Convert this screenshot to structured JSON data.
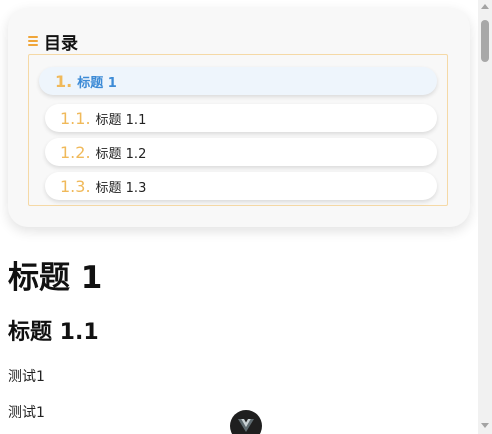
{
  "toc": {
    "title": "目录",
    "icon": "list-icon",
    "accent_color": "#f0a63a",
    "items": [
      {
        "number": "1.",
        "label": "标题 1",
        "active": true
      },
      {
        "number": "1.1.",
        "label": "标题 1.1",
        "active": false
      },
      {
        "number": "1.2.",
        "label": "标题 1.2",
        "active": false
      },
      {
        "number": "1.3.",
        "label": "标题 1.3",
        "active": false
      }
    ]
  },
  "content": {
    "h1": "标题 1",
    "h2": "标题 1.1",
    "paragraphs": [
      "测试1",
      "测试1"
    ]
  },
  "floating_button": {
    "icon": "vue-logo-icon"
  }
}
